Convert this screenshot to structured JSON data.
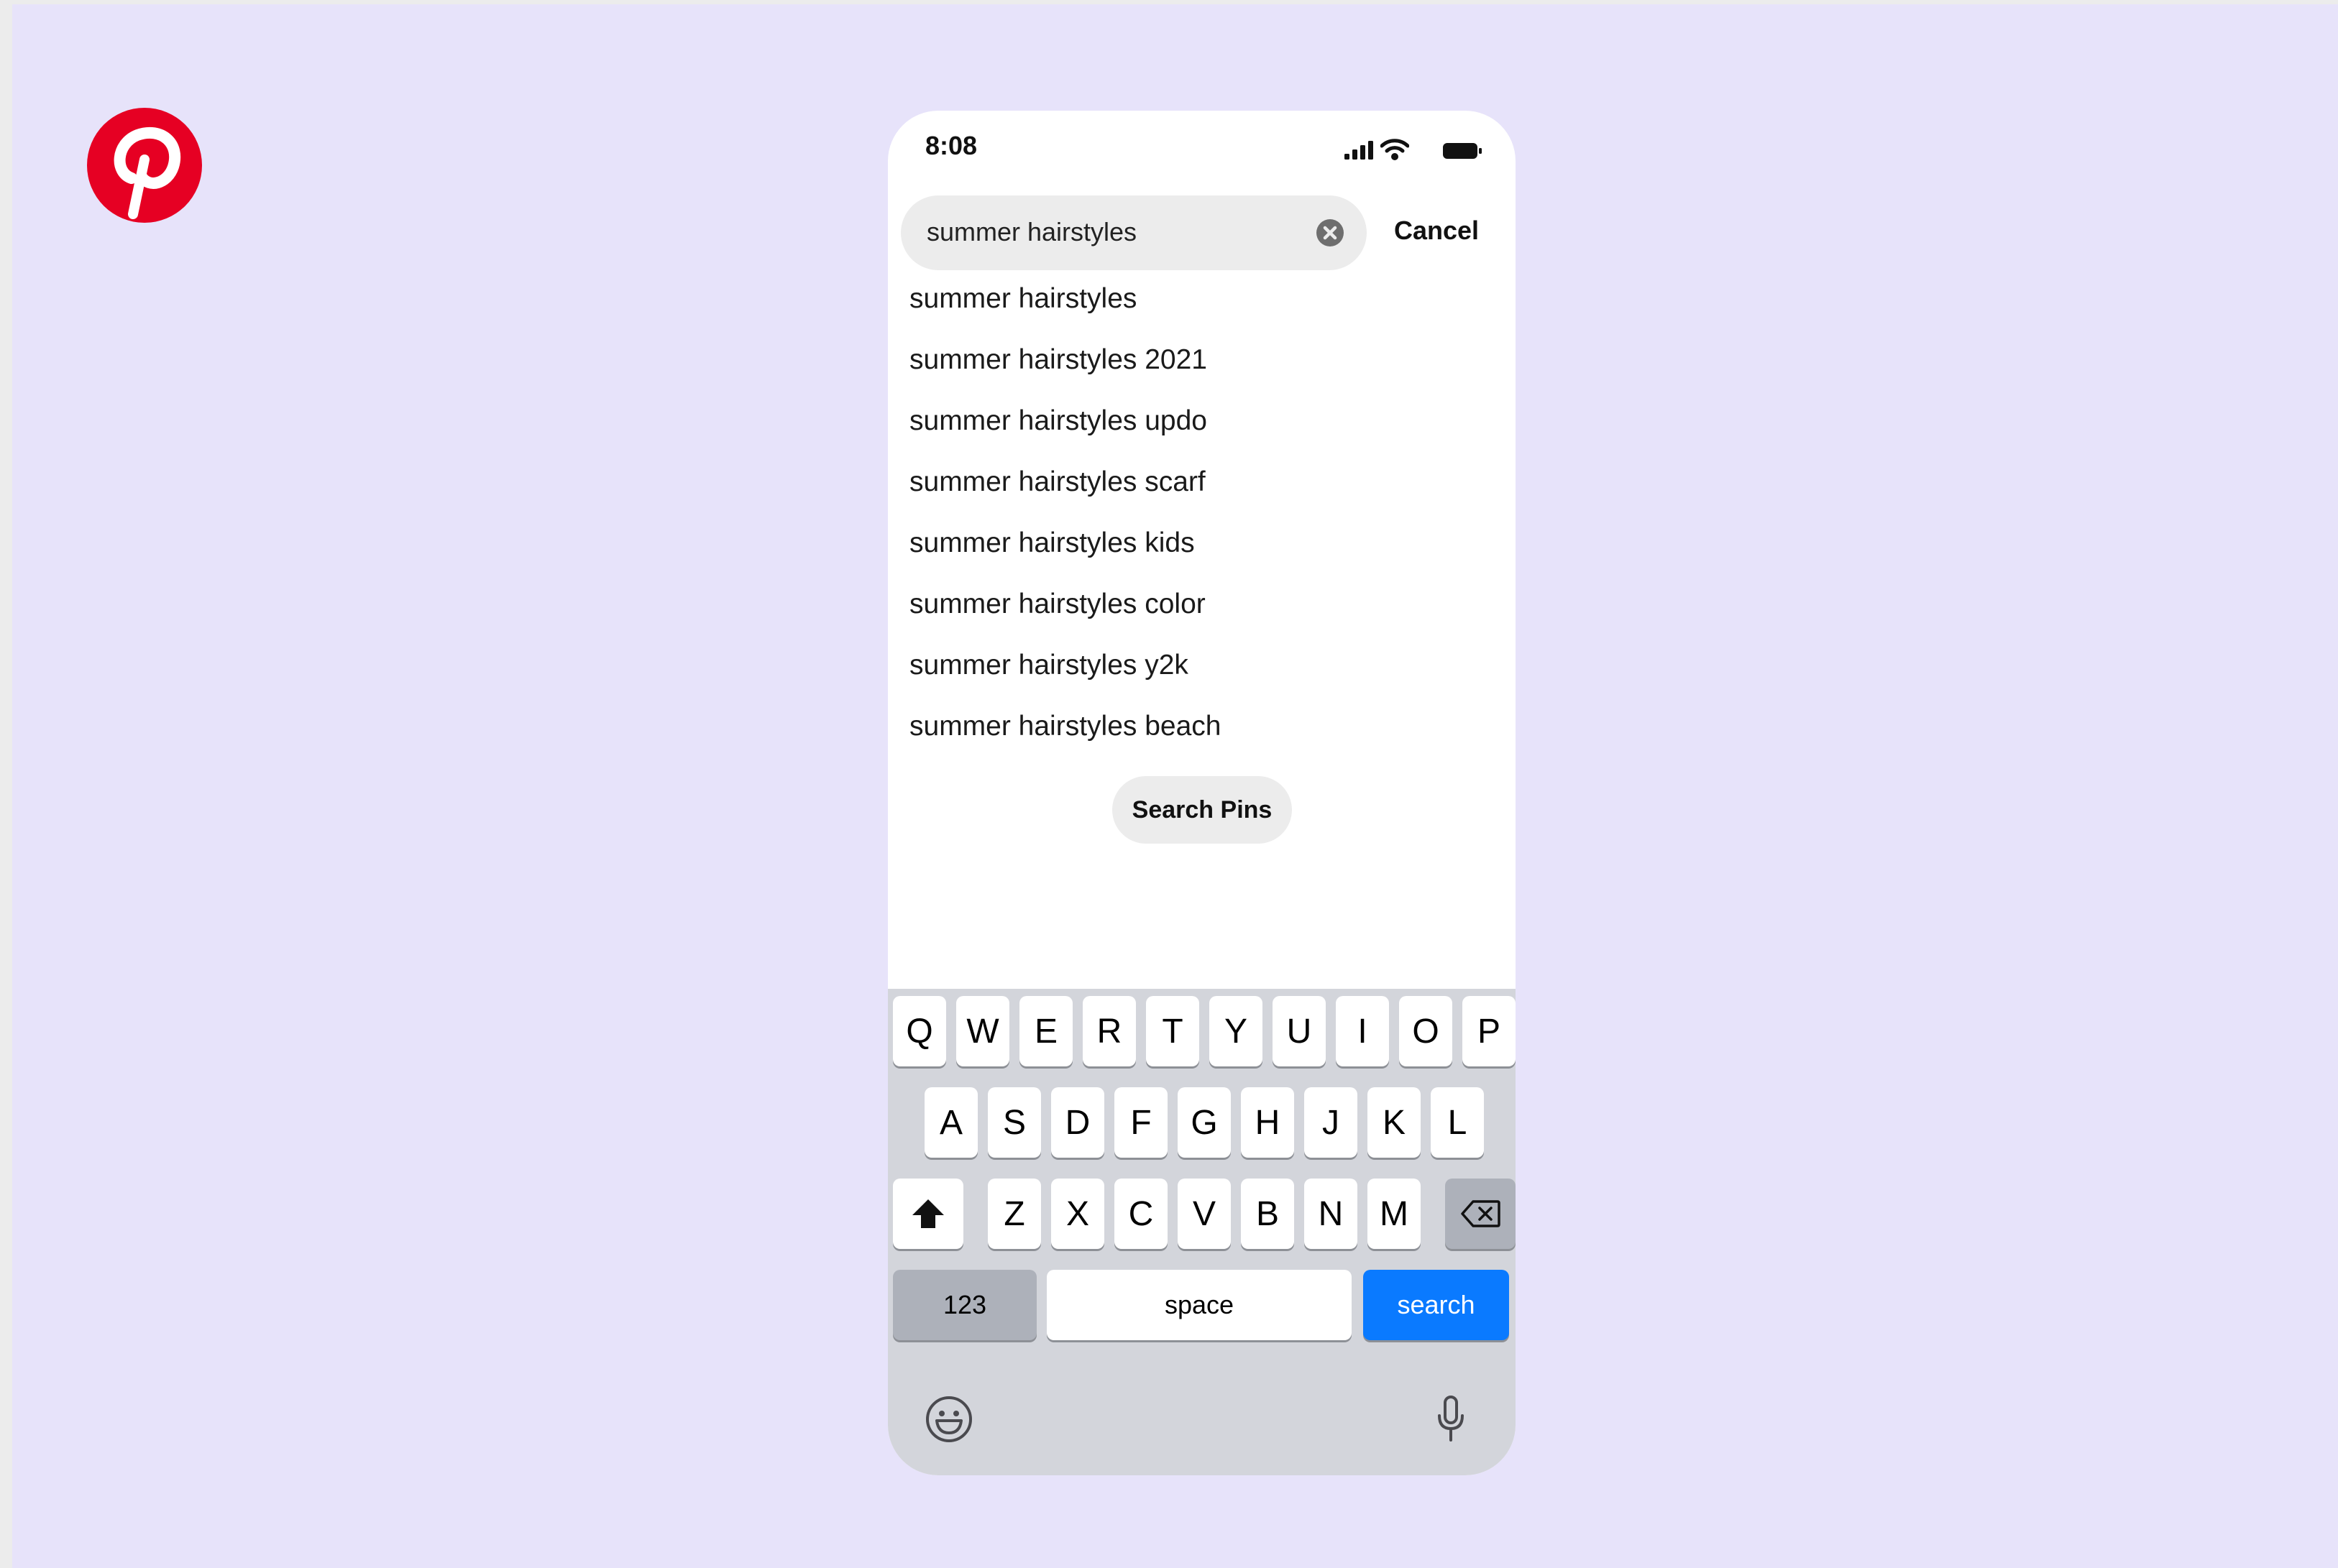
{
  "brand": {
    "logo_icon": "pinterest-logo-icon",
    "brand_color": "#e60023",
    "background_color": "#e7e3fa"
  },
  "status_bar": {
    "time": "8:08",
    "icons": [
      "cellular-signal-icon",
      "wifi-icon",
      "battery-icon"
    ]
  },
  "search": {
    "value": "summer hairstyles",
    "clear_icon": "clear-circle-icon",
    "cancel_label": "Cancel"
  },
  "suggestions": [
    "summer hairstyles",
    "summer hairstyles 2021",
    "summer hairstyles updo",
    "summer hairstyles scarf",
    "summer hairstyles kids",
    "summer hairstyles color",
    "summer hairstyles y2k",
    "summer hairstyles beach"
  ],
  "search_pins_label": "Search Pins",
  "keyboard": {
    "row1": [
      "Q",
      "W",
      "E",
      "R",
      "T",
      "Y",
      "U",
      "I",
      "O",
      "P"
    ],
    "row2": [
      "A",
      "S",
      "D",
      "F",
      "G",
      "H",
      "J",
      "K",
      "L"
    ],
    "row3": [
      "Z",
      "X",
      "C",
      "V",
      "B",
      "N",
      "M"
    ],
    "shift_icon": "shift-arrow-icon",
    "delete_icon": "backspace-icon",
    "numbers_label": "123",
    "space_label": "space",
    "search_label": "search",
    "search_key_color": "#0a7aff",
    "emoji_icon": "emoji-icon",
    "mic_icon": "microphone-icon"
  }
}
